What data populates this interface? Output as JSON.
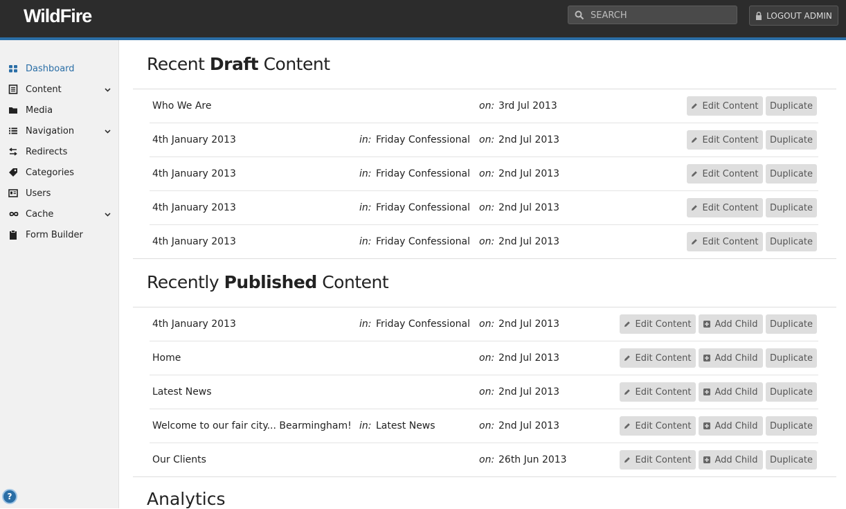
{
  "app": {
    "logo": "WildFire"
  },
  "header": {
    "search_placeholder": "SEARCH",
    "logout_label": "LOGOUT ADMIN"
  },
  "colors": {
    "accent": "#2a6ea6",
    "topbar": "#2c2c2c",
    "sidebar": "#f1f1f1",
    "button": "#dedede"
  },
  "sidebar": {
    "items": [
      {
        "label": "Dashboard",
        "icon": "dashboard-icon",
        "active": true
      },
      {
        "label": "Content",
        "icon": "document-icon",
        "expandable": true
      },
      {
        "label": "Media",
        "icon": "folder-icon"
      },
      {
        "label": "Navigation",
        "icon": "list-icon",
        "expandable": true
      },
      {
        "label": "Redirects",
        "icon": "redirect-icon"
      },
      {
        "label": "Categories",
        "icon": "tag-icon"
      },
      {
        "label": "Users",
        "icon": "users-icon"
      },
      {
        "label": "Cache",
        "icon": "infinity-icon",
        "expandable": true
      },
      {
        "label": "Form Builder",
        "icon": "clipboard-icon"
      }
    ],
    "help_label": "?"
  },
  "draft": {
    "title_pre": "Recent ",
    "title_bold": "Draft",
    "title_post": " Content",
    "in_label": "in:",
    "on_label": "on:",
    "edit_label": "Edit Content",
    "duplicate_label": "Duplicate",
    "rows": [
      {
        "name": "Who We Are",
        "in": "",
        "on": "3rd Jul 2013"
      },
      {
        "name": "4th January 2013",
        "in": "Friday Confessional",
        "on": "2nd Jul 2013"
      },
      {
        "name": "4th January 2013",
        "in": "Friday Confessional",
        "on": "2nd Jul 2013"
      },
      {
        "name": "4th January 2013",
        "in": "Friday Confessional",
        "on": "2nd Jul 2013"
      },
      {
        "name": "4th January 2013",
        "in": "Friday Confessional",
        "on": "2nd Jul 2013"
      }
    ]
  },
  "published": {
    "title_pre": "Recently ",
    "title_bold": "Published",
    "title_post": " Content",
    "in_label": "in:",
    "on_label": "on:",
    "edit_label": "Edit Content",
    "add_child_label": "Add Child",
    "duplicate_label": "Duplicate",
    "rows": [
      {
        "name": "4th January 2013",
        "in": "Friday Confessional",
        "on": "2nd Jul 2013"
      },
      {
        "name": "Home",
        "in": "",
        "on": "2nd Jul 2013"
      },
      {
        "name": "Latest News",
        "in": "",
        "on": "2nd Jul 2013"
      },
      {
        "name": "Welcome to our fair city... Bearmingham!",
        "in": "Latest News",
        "on": "2nd Jul 2013"
      },
      {
        "name": "Our Clients",
        "in": "",
        "on": "26th Jun 2013"
      }
    ]
  },
  "analytics": {
    "title": "Analytics"
  }
}
